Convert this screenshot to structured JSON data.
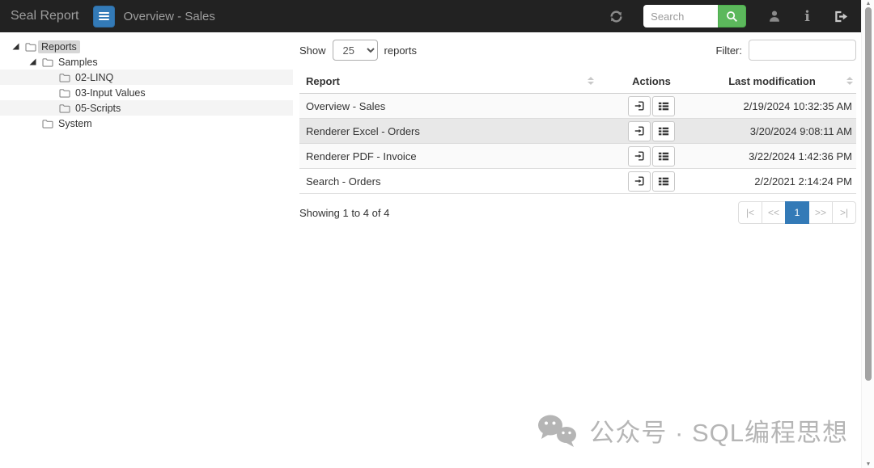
{
  "navbar": {
    "brand": "Seal Report",
    "title": "Overview - Sales",
    "search_placeholder": "Search",
    "icons": {
      "menu": "hamburger-icon",
      "refresh": "refresh-icon",
      "search": "magnifier-icon",
      "user": "user-icon",
      "info": "info-icon",
      "logout": "logout-icon"
    },
    "info_glyph": "i"
  },
  "tree": {
    "items": [
      {
        "label": "Reports"
      },
      {
        "label": "Samples"
      },
      {
        "label": "02-LINQ"
      },
      {
        "label": "03-Input Values"
      },
      {
        "label": "05-Scripts"
      },
      {
        "label": "System"
      }
    ]
  },
  "toolbar": {
    "show_label": "Show",
    "page_size": "25",
    "reports_label": "reports",
    "filter_label": "Filter:"
  },
  "table": {
    "columns": {
      "report": "Report",
      "actions": "Actions",
      "modified": "Last modification"
    },
    "rows": [
      {
        "name": "Overview - Sales",
        "modified": "2/19/2024 10:32:35 AM"
      },
      {
        "name": "Renderer Excel - Orders",
        "modified": "3/20/2024 9:08:11 AM"
      },
      {
        "name": "Renderer PDF - Invoice",
        "modified": "3/22/2024 1:42:36 PM"
      },
      {
        "name": "Search - Orders",
        "modified": "2/2/2021 2:14:24 PM"
      }
    ],
    "summary": "Showing 1 to 4 of 4"
  },
  "pagination": {
    "first": "|<",
    "prev": "<<",
    "page": "1",
    "next": ">>",
    "last": ">|"
  },
  "watermark": {
    "text": "公众号 · SQL编程思想"
  },
  "colors": {
    "navbar_bg": "#222222",
    "accent": "#337ab7",
    "success": "#5cb85c",
    "row_hover": "#e8e8e8",
    "stripe": "#f4f4f4"
  }
}
